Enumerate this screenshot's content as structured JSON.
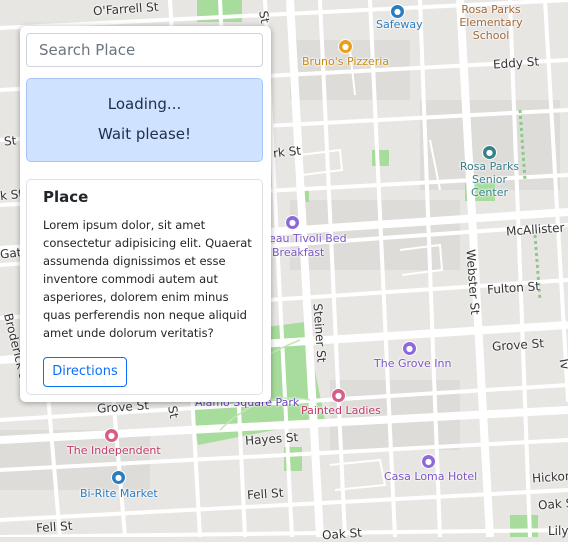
{
  "panel": {
    "search_placeholder": "Search Place",
    "loading_title": "Loading...",
    "loading_subtitle": "Wait please!",
    "card": {
      "title": "Place",
      "text": "Lorem ipsum dolor, sit amet consectetur adipisicing elit. Quaerat assumenda dignissimos et esse inventore commodi autem aut asperiores, dolorem enim minus quas perferendis non neque aliquid amet unde dolorum veritatis?",
      "button_label": "Directions"
    }
  },
  "map": {
    "streets": {
      "ofarrell": "O'Farrell St",
      "eddy": "Eddy St",
      "turk_left": "rk St",
      "mcallister": "McAllister St",
      "fulton": "Fulton St",
      "grove_right": "Grove St",
      "grove_left": "Grove St",
      "hayes": "Hayes St",
      "fell": "Fell St",
      "fell_left": "Fell St",
      "oak": "Oak St",
      "hickory": "Hickory",
      "lily": "Lily",
      "webster": "Webster St",
      "steiner": "Steiner St",
      "broderick": "Broderick St",
      "st_left": "St",
      "gate": "Gate",
      "k_st": "k St",
      "st_vertical": "St",
      "ivy": "Iv",
      "oak_bottom": "Oak St"
    },
    "pois": {
      "safeway": "Safeway",
      "rosa_parks_school": "Rosa Parks Elementary School",
      "brunos": "Bruno's Pizzeria",
      "rosa_parks_senior": "Rosa Parks Senior Center",
      "tivoli": "eau Tivoli Bed",
      "tivoli2": "Breakfast",
      "grove_inn": "The Grove Inn",
      "alamo": "Alamo Square Park",
      "painted_ladies": "Painted Ladies",
      "independent": "The Independent",
      "birite": "Bi-Rite Market",
      "casa_loma": "Casa Loma Hotel"
    }
  },
  "colors": {
    "map_bg": "#e8e6e3",
    "road": "#ffffff",
    "park": "#a8dc9c",
    "primary": "#0d6efd",
    "alert_bg": "#cfe2ff"
  }
}
